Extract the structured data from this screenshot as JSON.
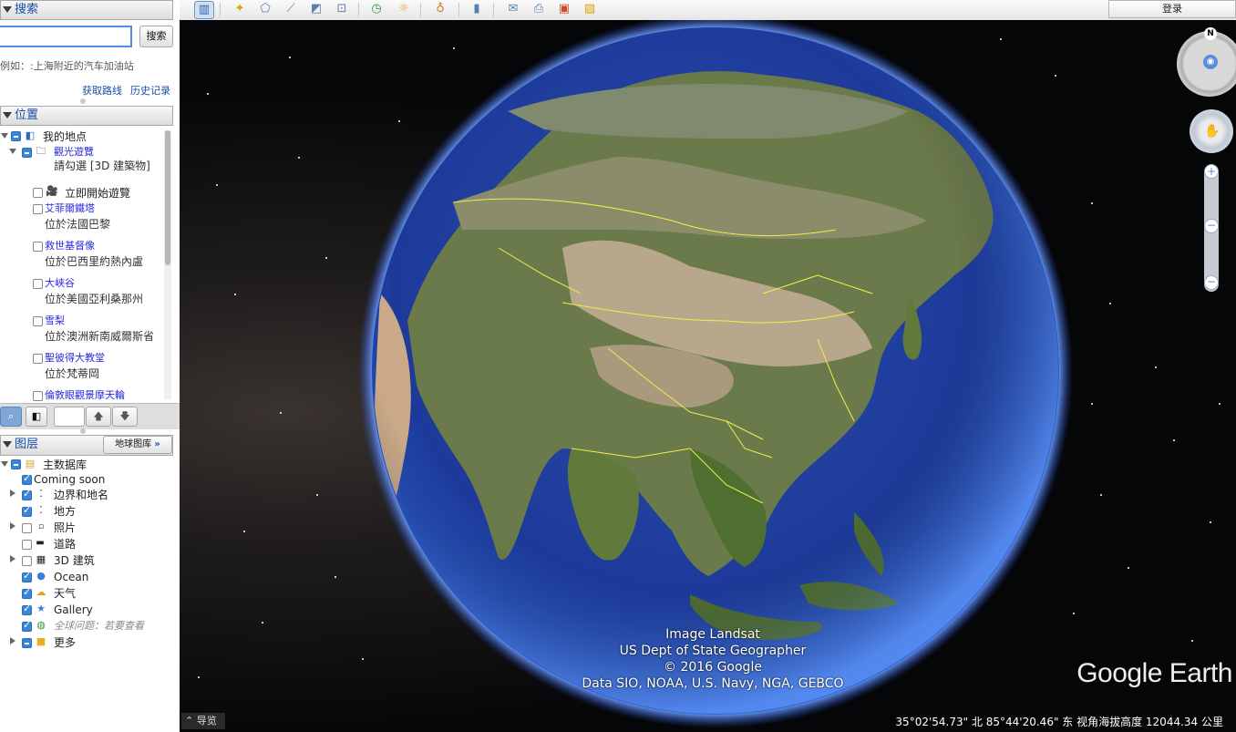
{
  "search": {
    "header": "搜索",
    "input_value": "",
    "button": "搜索",
    "hint": "例如：:上海附近的汽车加油站",
    "get_directions": "获取路线",
    "history": "历史记录"
  },
  "places": {
    "header": "位置",
    "my_places": "我的地点",
    "tour_folder": "觀光遊覽",
    "tour_note": "請勾選 [3D 建築物]",
    "start_tour": "立即開始遊覽",
    "items": [
      {
        "title": "艾菲爾鐵塔",
        "sub": "位於法國巴黎"
      },
      {
        "title": "救世基督像",
        "sub": "位於巴西里約熱內盧"
      },
      {
        "title": "大峽谷",
        "sub": "位於美國亞利桑那州"
      },
      {
        "title": "雪梨",
        "sub": "位於澳洲新南威爾斯省"
      },
      {
        "title": "聖彼得大教堂",
        "sub": "位於梵蒂岡"
      },
      {
        "title": "倫敦眼觀景摩天輪",
        "sub": ""
      }
    ]
  },
  "layers": {
    "header": "图层",
    "gallery_button": "地球图库",
    "items": [
      {
        "label": "主数据库",
        "check": "partial",
        "expand": "open"
      },
      {
        "label": "Coming soon",
        "check": "on",
        "expand": "none"
      },
      {
        "label": "边界和地名",
        "check": "on",
        "expand": "closed"
      },
      {
        "label": "地方",
        "check": "on",
        "expand": "none"
      },
      {
        "label": "照片",
        "check": "off",
        "expand": "closed"
      },
      {
        "label": "道路",
        "check": "off",
        "expand": "none"
      },
      {
        "label": "3D 建筑",
        "check": "off",
        "expand": "closed"
      },
      {
        "label": "Ocean",
        "check": "on",
        "expand": "none"
      },
      {
        "label": "天气",
        "check": "on",
        "expand": "none"
      },
      {
        "label": "Gallery",
        "check": "on",
        "expand": "none"
      },
      {
        "label": "全球问题：若要查看",
        "check": "on",
        "expand": "none"
      },
      {
        "label": "更多",
        "check": "partial",
        "expand": "closed"
      }
    ]
  },
  "toolbar": {
    "login": "登录"
  },
  "map": {
    "attribution": [
      "Image Landsat",
      "US Dept of State Geographer",
      "© 2016 Google",
      "Data SIO, NOAA, U.S. Navy, NGA, GEBCO"
    ],
    "brand": "Google Earth",
    "coords": "35°02'54.73\" 北    85°44'20.46\" 东  视角海拔高度 12044.34 公里",
    "nav_label": "导览",
    "compass_north": "N"
  },
  "colors": {
    "accent": "#1a4da8",
    "border_yellow": "#f0f04a",
    "ocean": "#1d3a9a"
  }
}
